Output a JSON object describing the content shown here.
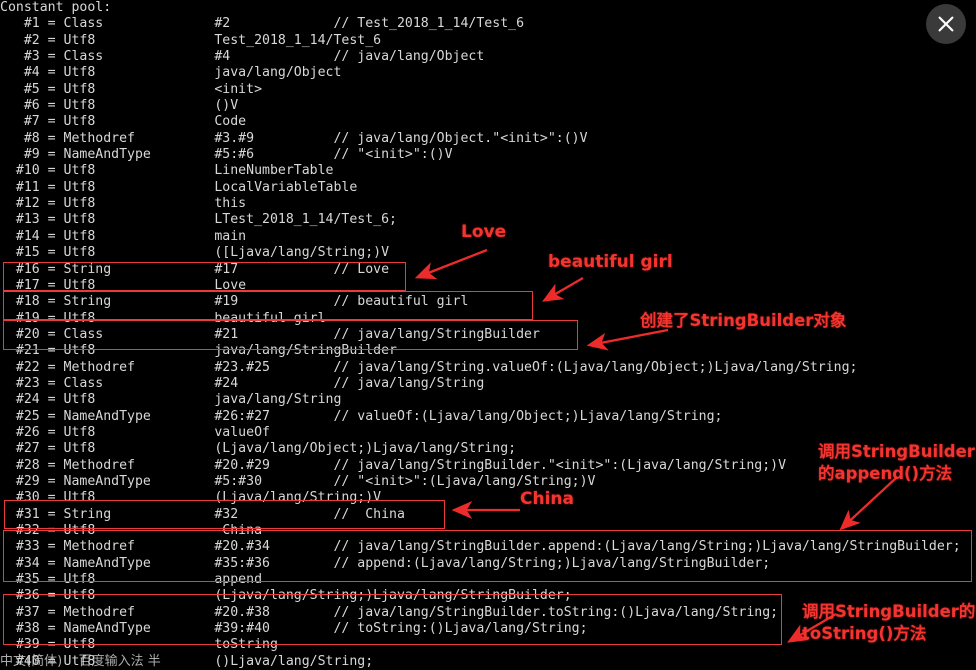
{
  "window": {
    "close_button_label": "close-window",
    "close_icon": "close-icon"
  },
  "terminal": {
    "header": "Constant pool:",
    "lines": [
      "Constant pool:",
      "   #1 = Class              #2             // Test_2018_1_14/Test_6",
      "   #2 = Utf8               Test_2018_1_14/Test_6",
      "   #3 = Class              #4             // java/lang/Object",
      "   #4 = Utf8               java/lang/Object",
      "   #5 = Utf8               <init>",
      "   #6 = Utf8               ()V",
      "   #7 = Utf8               Code",
      "   #8 = Methodref          #3.#9          // java/lang/Object.\"<init>\":()V",
      "   #9 = NameAndType        #5:#6          // \"<init>\":()V",
      "  #10 = Utf8               LineNumberTable",
      "  #11 = Utf8               LocalVariableTable",
      "  #12 = Utf8               this",
      "  #13 = Utf8               LTest_2018_1_14/Test_6;",
      "  #14 = Utf8               main",
      "  #15 = Utf8               ([Ljava/lang/String;)V",
      "  #16 = String             #17            // Love",
      "  #17 = Utf8               Love",
      "  #18 = String             #19            // beautiful girl",
      "  #19 = Utf8               beautiful girl",
      "  #20 = Class              #21            // java/lang/StringBuilder",
      "  #21 = Utf8               java/lang/StringBuilder",
      "  #22 = Methodref          #23.#25        // java/lang/String.valueOf:(Ljava/lang/Object;)Ljava/lang/String;",
      "  #23 = Class              #24            // java/lang/String",
      "  #24 = Utf8               java/lang/String",
      "  #25 = NameAndType        #26:#27        // valueOf:(Ljava/lang/Object;)Ljava/lang/String;",
      "  #26 = Utf8               valueOf",
      "  #27 = Utf8               (Ljava/lang/Object;)Ljava/lang/String;",
      "  #28 = Methodref          #20.#29        // java/lang/StringBuilder.\"<init>\":(Ljava/lang/String;)V",
      "  #29 = NameAndType        #5:#30         // \"<init>\":(Ljava/lang/String;)V",
      "  #30 = Utf8               (Ljava/lang/String;)V",
      "  #31 = String             #32            //  China",
      "  #32 = Utf8                China",
      "  #33 = Methodref          #20.#34        // java/lang/StringBuilder.append:(Ljava/lang/String;)Ljava/lang/StringBuilder;",
      "  #34 = NameAndType        #35:#36        // append:(Ljava/lang/String;)Ljava/lang/StringBuilder;",
      "  #35 = Utf8               append",
      "  #36 = Utf8               (Ljava/lang/String;)Ljava/lang/StringBuilder;",
      "  #37 = Methodref          #20.#38        // java/lang/StringBuilder.toString:()Ljava/lang/String;",
      "  #38 = NameAndType        #39:#40        // toString:()Ljava/lang/String;",
      "  #39 = Utf8               toString",
      "  #40 = Utf8               ()Ljava/lang/String;"
    ],
    "ime_line": "中文(简体)    百度输入法 半"
  },
  "annotations": {
    "color": "#e83b3b",
    "labels": [
      {
        "id": "love",
        "text": "Love"
      },
      {
        "id": "beautiful-girl",
        "text": "beautiful girl"
      },
      {
        "id": "stringbuilder-created",
        "text": "创建了StringBuilder对象"
      },
      {
        "id": "china",
        "text": "China"
      },
      {
        "id": "append-method",
        "text": "调用StringBuilder\n的append()方法"
      },
      {
        "id": "tostring-method",
        "text": "调用StringBuilder的\ntoString()方法"
      }
    ]
  }
}
